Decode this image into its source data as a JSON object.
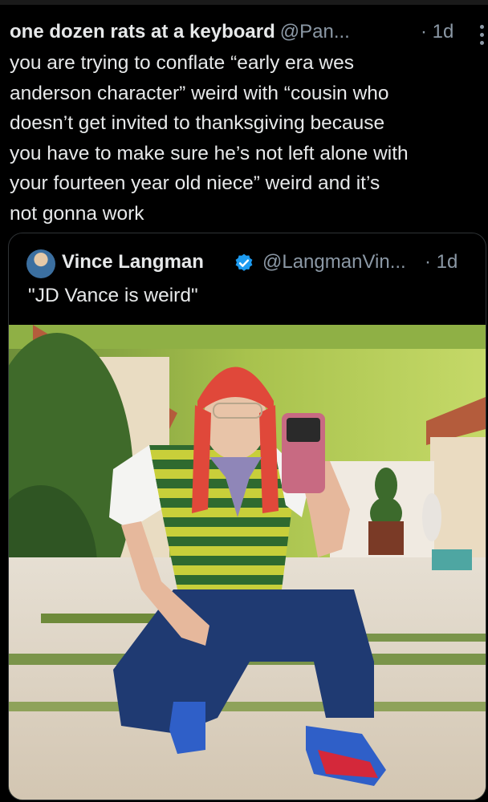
{
  "post": {
    "author_name": "one dozen rats at a keyboard",
    "author_handle": "@Pan...",
    "timestamp": "· 1d",
    "text": "you are trying to conflate “early era wes\nanderson character” weird with “cousin who\ndoesn’t get invited to thanksgiving because\nyou have to make sure he’s not left alone with\nyour fourteen year old niece” weird and it’s\nnot gonna work",
    "more_icon": "more-vertical-icon"
  },
  "quoted": {
    "author_name": "Vince Langman",
    "author_handle": "@LangmanVin...",
    "timestamp": "· 1d",
    "text": "\"JD Vance is weird\"",
    "verified_icon": "verified-badge-icon",
    "verified_color": "#1d9bf0"
  },
  "colors": {
    "background": "#000000",
    "text": "#e7e9ea",
    "secondary_text": "#8b98a5",
    "border": "#2f3336"
  }
}
